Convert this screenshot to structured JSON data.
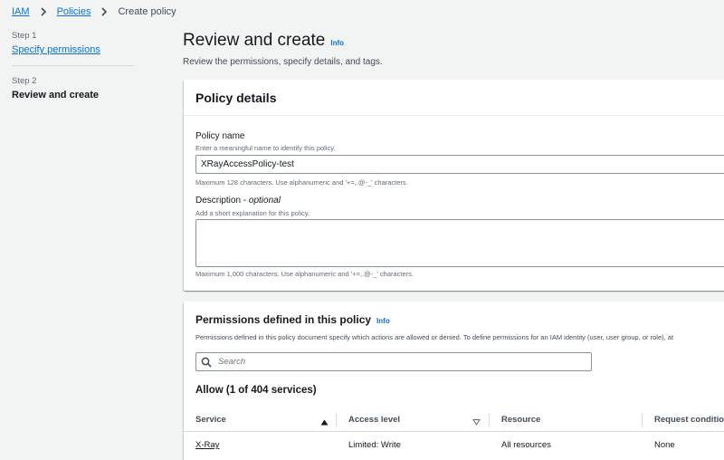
{
  "breadcrumb": {
    "items": [
      {
        "label": "IAM"
      },
      {
        "label": "Policies"
      },
      {
        "label": "Create policy"
      }
    ]
  },
  "steps": [
    {
      "step_label": "Step 1",
      "name": "Specify permissions"
    },
    {
      "step_label": "Step 2",
      "name": "Review and create"
    }
  ],
  "header": {
    "title": "Review and create",
    "info": "Info",
    "description": "Review the permissions, specify details, and tags."
  },
  "policy_details": {
    "title": "Policy details",
    "name_label": "Policy name",
    "name_hint": "Enter a meaningful name to identify this policy.",
    "name_value": "XRayAccessPolicy-test",
    "name_constraint": "Maximum 128 characters. Use alphanumeric and '+=,.@-_' characters.",
    "desc_label": "Description - ",
    "desc_optional": "optional",
    "desc_hint": "Add a short explanation for this policy.",
    "desc_constraint": "Maximum 1,000 characters. Use alphanumeric and '+=,.@-_' characters."
  },
  "permissions": {
    "title": "Permissions defined in this policy",
    "info": "Info",
    "description": "Permissions defined in this policy document specify which actions are allowed or denied. To define permissions for an IAM identity (user, user group, or role), at",
    "search_placeholder": "Search",
    "allow_title": "Allow (1 of 404 services)",
    "columns": [
      "Service",
      "Access level",
      "Resource",
      "Request condition"
    ],
    "rows": [
      {
        "service": "X-Ray",
        "access_level": "Limited: Write",
        "resource": "All resources",
        "request_condition": "None"
      }
    ]
  },
  "icons": {
    "breadcrumb_separator": "chevron-right-icon",
    "search": "search-icon",
    "sort_ascending": "caret-up-icon",
    "sort_descending": "caret-down-icon"
  },
  "colors": {
    "link": "#0972d3",
    "background": "#f2f3f3",
    "card": "#ffffff"
  }
}
